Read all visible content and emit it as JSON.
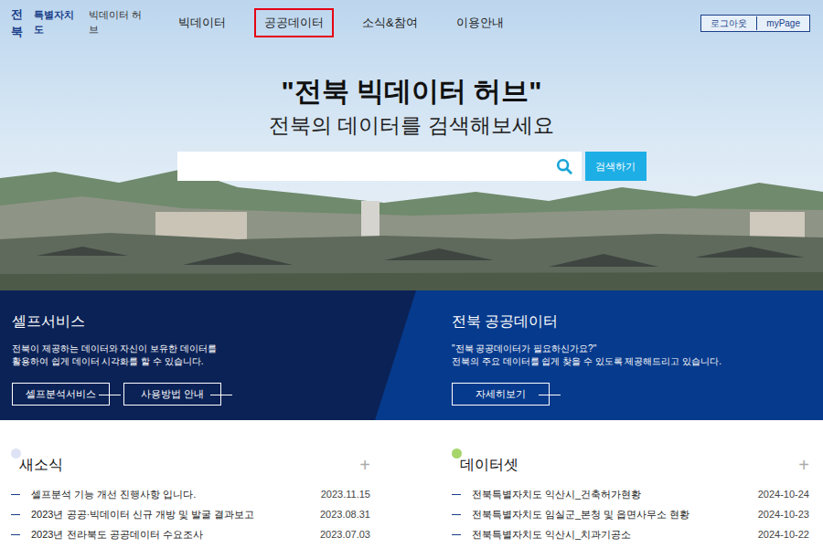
{
  "header": {
    "logo": {
      "brand": "전북",
      "region": "특별자치도",
      "title": "빅데이터 허브"
    },
    "nav": [
      {
        "label": "빅데이터",
        "selected": false
      },
      {
        "label": "공공데이터",
        "selected": true
      },
      {
        "label": "소식&참여",
        "selected": false
      },
      {
        "label": "이용안내",
        "selected": false
      }
    ],
    "account": [
      "로그아웃",
      "myPage"
    ]
  },
  "hero": {
    "title": "\"전북 빅데이터 허브\"",
    "subtitle": "전북의 데이터를 검색해보세요",
    "search_button": "검색하기"
  },
  "self_service": {
    "title": "셀프서비스",
    "description": [
      "전북이 제공하는 데이터와 자신이 보유한 데이터를",
      "활용하여 쉽게 데이터 시각화를 할 수 있습니다."
    ],
    "buttons": [
      "셀프분석서비스",
      "사용방법 안내"
    ]
  },
  "public_data": {
    "title": "전북 공공데이터",
    "description": [
      "\"전북 공공데이터가 필요하신가요?\"",
      "전북의 주요 데이터를 쉽게 찾을 수 있도록 제공해드리고 있습니다."
    ],
    "button": "자세히보기"
  },
  "news": {
    "title": "새소식",
    "more": "+",
    "items": [
      {
        "title": "셀프분석 기능 개선 진행사항 입니다.",
        "date": "2023.11.15"
      },
      {
        "title": "2023년 공공·빅데이터 신규 개방 및 발굴 결과보고",
        "date": "2023.08.31"
      },
      {
        "title": "2023년 전라북도 공공데이터 수요조사",
        "date": "2023.07.03"
      }
    ]
  },
  "datasets": {
    "title": "데이터셋",
    "more": "+",
    "items": [
      {
        "title": "전북특별자치도 익산시_건축허가현황",
        "date": "2024-10-24"
      },
      {
        "title": "전북특별자치도 임실군_본청 및 읍면사무소 현황",
        "date": "2024-10-23"
      },
      {
        "title": "전북특별자치도 익산시_치과기공소",
        "date": "2024-10-22"
      }
    ]
  }
}
